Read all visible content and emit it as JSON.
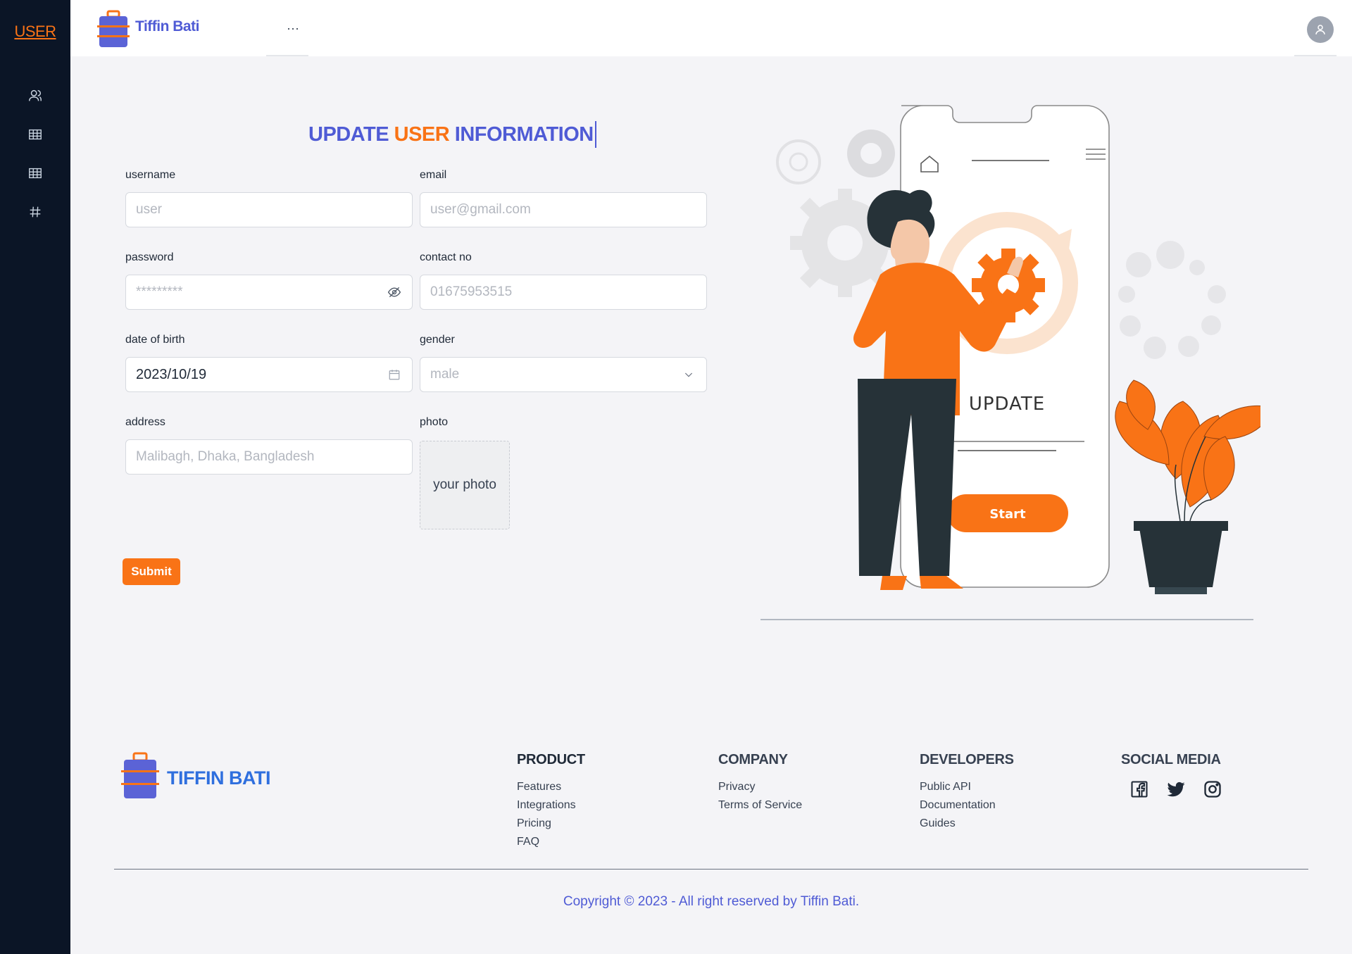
{
  "sidebar": {
    "brand": "USER",
    "items": [
      {
        "icon": "users-icon"
      },
      {
        "icon": "table-icon"
      },
      {
        "icon": "table-icon"
      },
      {
        "icon": "hash-icon"
      }
    ]
  },
  "topbar": {
    "title": "Tiffin Bati",
    "menu_label": "···"
  },
  "form": {
    "title_part1": "UPDATE",
    "title_part2": "USER",
    "title_part3": "INFORMATION",
    "username": {
      "label": "username",
      "placeholder": "user"
    },
    "email": {
      "label": "email",
      "placeholder": "user@gmail.com"
    },
    "password": {
      "label": "password",
      "placeholder": "*********"
    },
    "contact": {
      "label": "contact no",
      "placeholder": "01675953515"
    },
    "dob": {
      "label": "date of birth",
      "value": "2023/10/19"
    },
    "gender": {
      "label": "gender",
      "value": "male"
    },
    "address": {
      "label": "address",
      "placeholder": "Malibagh, Dhaka, Bangladesh"
    },
    "photo": {
      "label": "photo",
      "placeholder": "your photo"
    },
    "submit_label": "Submit"
  },
  "illustration": {
    "screen_title": "UPDATE",
    "button_label": "Start"
  },
  "footer": {
    "brand": "TIFFIN BATI",
    "columns": [
      {
        "title": "PRODUCT",
        "links": [
          "Features",
          "Integrations",
          "Pricing",
          "FAQ"
        ]
      },
      {
        "title": "COMPANY",
        "links": [
          "Privacy",
          "Terms of Service"
        ]
      },
      {
        "title": "DEVELOPERS",
        "links": [
          "Public API",
          "Documentation",
          "Guides"
        ]
      }
    ],
    "social_title": "SOCIAL MEDIA",
    "social": [
      "facebook-icon",
      "twitter-icon",
      "instagram-icon"
    ],
    "copyright": "Copyright © 2023 - All right reserved by Tiffin Bati."
  },
  "colors": {
    "accent": "#f97316",
    "brand_blue": "#4f5bd5",
    "sidebar": "#0b1526"
  }
}
